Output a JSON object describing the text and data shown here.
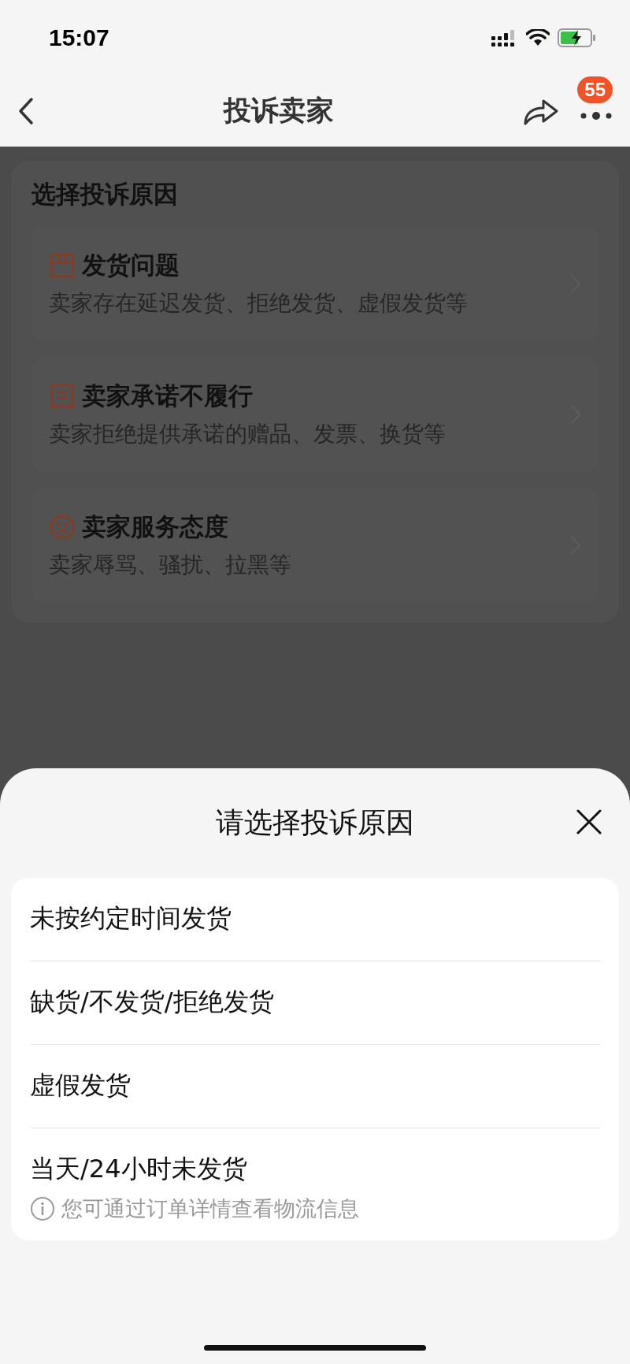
{
  "status_bar": {
    "time": "15:07"
  },
  "nav": {
    "title": "投诉卖家",
    "badge": "55"
  },
  "reasons_card": {
    "title": "选择投诉原因",
    "items": [
      {
        "kind": "shipping",
        "title": "发货问题",
        "description": "卖家存在延迟发货、拒绝发货、虚假发货等"
      },
      {
        "kind": "promise",
        "title": "卖家承诺不履行",
        "description": "卖家拒绝提供承诺的赠品、发票、换货等"
      },
      {
        "kind": "attitude",
        "title": "卖家服务态度",
        "description": "卖家辱骂、骚扰、拉黑等"
      }
    ]
  },
  "sheet": {
    "title": "请选择投诉原因",
    "options": [
      {
        "label": "未按约定时间发货"
      },
      {
        "label": "缺货/不发货/拒绝发货"
      },
      {
        "label": "虚假发货"
      },
      {
        "label": "当天/24小时未发货",
        "hint": "您可通过订单详情查看物流信息"
      }
    ]
  }
}
